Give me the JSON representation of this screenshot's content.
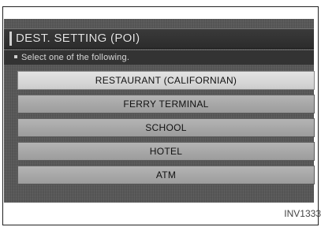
{
  "screen": {
    "title": "DEST. SETTING (POI)",
    "instruction": "Select one of the following.",
    "menu_items": [
      {
        "label": "RESTAURANT (CALIFORNIAN)",
        "selected": true
      },
      {
        "label": "FERRY TERMINAL",
        "selected": false
      },
      {
        "label": "SCHOOL",
        "selected": false
      },
      {
        "label": "HOTEL",
        "selected": false
      },
      {
        "label": "ATM",
        "selected": false
      }
    ]
  },
  "figure_code": "INV1333"
}
